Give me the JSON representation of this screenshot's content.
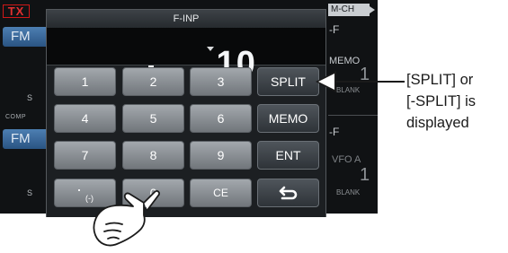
{
  "left_strip": {
    "tx": "TX",
    "mode_top": "FM",
    "mode_bottom": "FM",
    "s_top": "S",
    "comp": "COMP",
    "s_bottom": "S"
  },
  "right_strip": {
    "channel_badge": "M-CH",
    "f_top": "-F",
    "memo": "MEMO",
    "memo_num": "1",
    "blank_top": "BLANK",
    "f_bottom": "-F",
    "vfo": "VFO A",
    "vfo_num": "1",
    "blank_bottom": "BLANK"
  },
  "dialog": {
    "title": "F-INP",
    "frequency": ".10"
  },
  "keypad": {
    "k1": "1",
    "k2": "2",
    "k3": "3",
    "split": "SPLIT",
    "k4": "4",
    "k5": "5",
    "k6": "6",
    "memo": "MEMO",
    "k7": "7",
    "k8": "8",
    "k9": "9",
    "ent": "ENT",
    "dot": "·",
    "minus": "(-)",
    "k0": "0",
    "ce": "CE",
    "back": "⮌"
  },
  "callout": {
    "line1": "[SPLIT] or",
    "line2": "[-SPLIT] is",
    "line3": "displayed"
  }
}
